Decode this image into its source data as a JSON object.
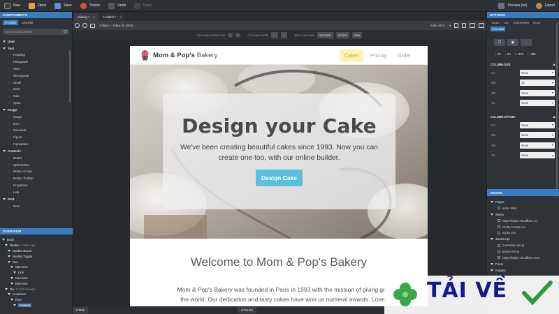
{
  "toolbar": {
    "new": "New",
    "open": "Open",
    "save": "Save",
    "theme": "Theme",
    "undo": "Undo",
    "redo": "Redo",
    "preview": "Preview (on)",
    "export": "Export"
  },
  "left": {
    "header": "COMPONENTS",
    "tabs": [
      "STUDIO",
      "ONLINE"
    ],
    "search_placeholder": "Search components",
    "categories": [
      {
        "name": "User",
        "items": []
      },
      {
        "name": "Text",
        "items": [
          "Heading",
          "Paragraph",
          "Alert",
          "Blockquote",
          "Small",
          "Bold",
          "Italic",
          "Span"
        ]
      },
      {
        "name": "Image",
        "items": [
          "Image",
          "Icon",
          "Carousel",
          "Figure",
          "Figcaption"
        ]
      },
      {
        "name": "Controls",
        "items": [
          "Button",
          "Split Button",
          "Button Group",
          "Button Toolbar",
          "Dropdown",
          "Link"
        ]
      },
      {
        "name": "Grid",
        "items": [
          "Row"
        ]
      }
    ]
  },
  "overview": {
    "header": "OVERVIEW",
    "nodes": [
      {
        "label": "Body",
        "note": "",
        "indent": 0
      },
      {
        "label": "Navbar",
        "note": "#cake-nav",
        "indent": 1
      },
      {
        "label": "Navbar Brand",
        "note": "",
        "indent": 2
      },
      {
        "label": "Navbar Toggle",
        "note": "",
        "indent": 2
      },
      {
        "label": "Nav",
        "note": "",
        "indent": 2
      },
      {
        "label": "Nav Item",
        "note": "",
        "indent": 3
      },
      {
        "label": "Link",
        "note": "",
        "indent": 4
      },
      {
        "label": "Nav Item",
        "note": "",
        "indent": 3
      },
      {
        "label": "Nav Item",
        "note": "",
        "indent": 3
      },
      {
        "label": "Div",
        "note": "#cuffin-header",
        "indent": 1
      },
      {
        "label": "Container",
        "note": "",
        "indent": 2
      },
      {
        "label": "Row",
        "note": "",
        "indent": 3
      },
      {
        "label": "Column",
        "note": "",
        "indent": 4,
        "selected": true
      }
    ]
  },
  "doc_tabs": [
    "Glassy *",
    "Untitled *"
  ],
  "viewbar": {
    "size": "1050px × 239px @ 100%",
    "file": "index.html"
  },
  "colbar": {
    "position_label": "COLUMN POSITION",
    "size_label": "COLUMN SIZE",
    "add_label": "ADD COLUMN",
    "before": "BEFORE",
    "after": "AFTER",
    "end": "END"
  },
  "site": {
    "brand_bold": "Mom & Pop's",
    "brand_rest": "Bakery",
    "nav": [
      "Cakes",
      "Pricing",
      "Order"
    ],
    "hero_title": "Design your Cake",
    "hero_text": "We've been creating beautiful cakes since 1993. Now you can create one too, with our online builder.",
    "hero_button": "Design Cake",
    "welcome": "Welcome to Mom & Pop's Bakery",
    "about_1": "Mom & Pop's Bakery was founded in Paris in 1993 with the mission of giving great cak",
    "about_2": "the world. Our dedication and tasty cakes have won us numeral awards. Lorem ipsu"
  },
  "right": {
    "header": "OPTIONS",
    "tabs": [
      "BODY",
      "DIV",
      "CONTAINER",
      "ROW",
      "COLUMN"
    ],
    "dims": [
      {
        "k": "t",
        "v": "27"
      },
      {
        "k": "l",
        "v": "84"
      },
      {
        "k": "w",
        "v": "970"
      },
      {
        "k": "h",
        "v": "399"
      }
    ],
    "col_size_label": "COLUMN SIZE",
    "col_size": [
      {
        "bp": "LG",
        "val": "None"
      },
      {
        "bp": "MD",
        "val": "12"
      },
      {
        "bp": "SM",
        "val": "None"
      },
      {
        "bp": "XS",
        "val": "None"
      }
    ],
    "col_offset_label": "COLUMN OFFSET",
    "col_offset": [
      {
        "bp": "LG",
        "val": "None"
      },
      {
        "bp": "MD",
        "val": "None"
      },
      {
        "bp": "SM",
        "val": "None"
      },
      {
        "bp": "XS",
        "val": "None"
      }
    ]
  },
  "design": {
    "header": "DESIGN",
    "pages_label": "Pages",
    "pages": [
      "index.html"
    ],
    "styles_label": "Styles",
    "styles": [
      "https://cdnjs.cloudflare.co",
      "Pretty-Footer.css",
      "styles.css"
    ],
    "js_label": "JavaScript",
    "js": [
      "bootstrap.min.js",
      "jquery.min.js",
      "https://cdnjs.cloudflare.com"
    ],
    "fonts_label": "Fonts",
    "images_label": "Images"
  },
  "bottom": {
    "html_tab": "HTML",
    "styles_tab": "STYLES"
  },
  "watermark": "TẢI VỀ",
  "colors": {
    "accent": "#3a7cbd",
    "hero_button": "#5bc0de",
    "nav_active_bg": "#fcf3b5"
  }
}
